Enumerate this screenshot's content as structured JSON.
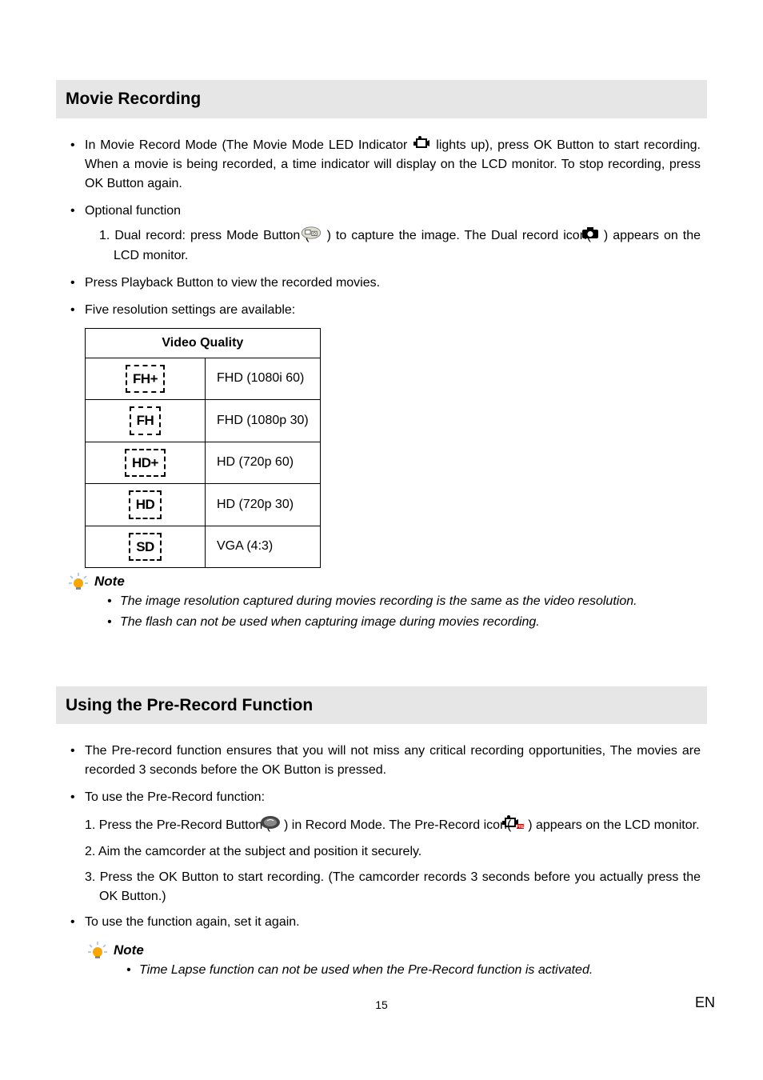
{
  "section1": {
    "title": "Movie Recording",
    "b1a": "In Movie Record Mode (The Movie Mode LED Indicator ",
    "b1b": " lights up), press OK Button to start recording. When a movie is being recorded, a time indicator will display on the LCD monitor. To stop recording, press OK Button again.",
    "b2": "Optional function",
    "b2s1a": "1. Dual record: press Mode Button (",
    "b2s1b": ") to capture the image. The Dual record icon( ",
    "b2s1c": " ) appears on the LCD monitor.",
    "b3": "Press Playback Button to view the recorded movies.",
    "b4": "Five resolution settings are available:",
    "tableHeader": "Video Quality",
    "rows": [
      {
        "icon": "FH+",
        "label": "FHD (1080i 60)"
      },
      {
        "icon": "FH",
        "label": "FHD (1080p 30)"
      },
      {
        "icon": "HD+",
        "label": "HD (720p 60)"
      },
      {
        "icon": "HD",
        "label": "HD (720p 30)"
      },
      {
        "icon": "SD",
        "label": "VGA (4:3)"
      }
    ],
    "noteTitle": "Note",
    "note1": "The image resolution captured during movies recording is the same as the video resolution.",
    "note2": "The flash can not be used when capturing image during movies recording."
  },
  "section2": {
    "title": "Using the Pre-Record Function",
    "b1": "The Pre-record function ensures that you will not miss any critical recording opportunities, The movies are recorded 3 seconds before the OK Button is pressed.",
    "b2": "To use the Pre-Record function:",
    "s1a": "1. Press the Pre-Record Button (",
    "s1b": ") in Record Mode. The Pre-Record icon( ",
    "s1c": " ) appears on the LCD monitor.",
    "s2": "2. Aim the camcorder at the subject and position it securely.",
    "s3": "3. Press the OK Button to start recording. (The camcorder records 3 seconds before you actually press the OK Button.)",
    "b3": "To use the function again, set it again.",
    "noteTitle": "Note",
    "note1": "Time Lapse function can not be used when the Pre-Record function is activated."
  },
  "footer": {
    "page": "15",
    "lang": "EN"
  }
}
